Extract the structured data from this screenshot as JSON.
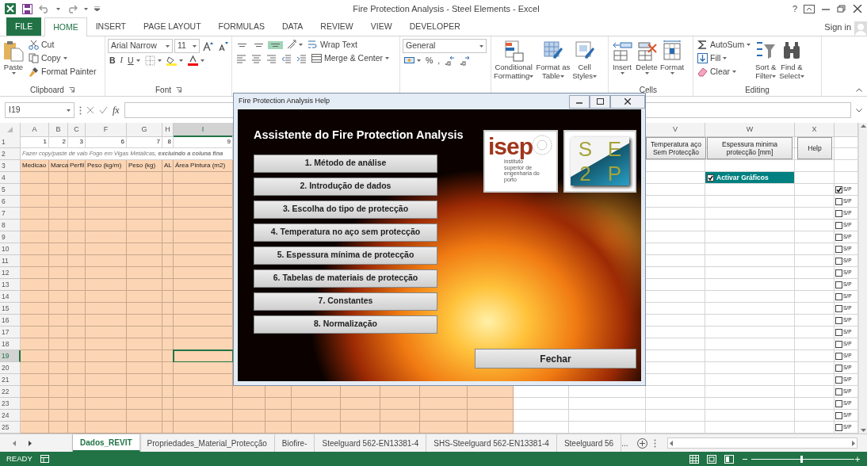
{
  "title_bar": {
    "title": "Fire Protection Analysis - Steel Elements - Excel",
    "help": "?"
  },
  "ribbon_tabs": [
    {
      "label": "FILE",
      "kind": "file",
      "selected": false
    },
    {
      "label": "HOME",
      "kind": "tab",
      "selected": true
    },
    {
      "label": "INSERT",
      "kind": "tab",
      "selected": false
    },
    {
      "label": "PAGE LAYOUT",
      "kind": "tab",
      "selected": false
    },
    {
      "label": "FORMULAS",
      "kind": "tab",
      "selected": false
    },
    {
      "label": "DATA",
      "kind": "tab",
      "selected": false
    },
    {
      "label": "REVIEW",
      "kind": "tab",
      "selected": false
    },
    {
      "label": "VIEW",
      "kind": "tab",
      "selected": false
    },
    {
      "label": "DEVELOPER",
      "kind": "tab",
      "selected": false
    }
  ],
  "sign_in": "Sign in",
  "ribbon": {
    "clipboard": {
      "label": "Clipboard",
      "paste": "Paste",
      "cut": "Cut",
      "copy": "Copy",
      "format_painter": "Format Painter"
    },
    "font": {
      "label": "Font",
      "name": "Arial Narrow",
      "size": "11",
      "bold": "B",
      "italic": "I",
      "underline": "U"
    },
    "alignment": {
      "vertical": [
        {
          "selected": false
        },
        {
          "selected": false
        },
        {
          "selected": true
        }
      ],
      "wrap_text": "Wrap Text",
      "merge_center": "Merge & Center"
    },
    "number": {
      "format": "General",
      "percent": "%",
      "comma": ","
    },
    "styles": [
      {
        "lines": [
          "Conditional",
          "Formatting"
        ]
      },
      {
        "lines": [
          "Format as",
          "Table"
        ]
      },
      {
        "lines": [
          "Cell",
          "Styles"
        ]
      }
    ],
    "cells": {
      "label": "Cells",
      "items": [
        "Insert",
        "Delete",
        "Format"
      ]
    },
    "editing": {
      "label": "Editing",
      "autosum": "AutoSum",
      "fill": "Fill",
      "clear": "Clear",
      "sort": [
        "Sort &",
        "Filter"
      ],
      "find": [
        "Find &",
        "Select"
      ]
    }
  },
  "formula_bar": {
    "name_box": "I19",
    "function_label": "fx"
  },
  "sheet": {
    "columns_left": [
      {
        "label": "A",
        "selected": false
      },
      {
        "label": "B",
        "selected": false
      },
      {
        "label": "C",
        "selected": false
      },
      {
        "label": "F",
        "selected": false
      },
      {
        "label": "G",
        "selected": false
      },
      {
        "label": "H",
        "selected": false
      },
      {
        "label": "I",
        "selected": true
      }
    ],
    "columns_right": [
      {
        "label": "V"
      },
      {
        "label": "W"
      },
      {
        "label": "X"
      }
    ],
    "rows": [
      {
        "number": "1",
        "selected": false,
        "cells": [
          "1",
          "2",
          "3",
          "6",
          "7",
          "8",
          "9"
        ]
      },
      {
        "number": "2",
        "selected": false,
        "note": "Fazer copy/paste de valo Fogo em Vigas Metálicas,  **excluindo a coluna fina**"
      },
      {
        "number": "3",
        "selected": false,
        "headers": [
          "Medicao",
          "Marca",
          "Perfil",
          "Peso (kg/m)",
          "Peso (kg)",
          "AL",
          "Área Pintura (m2)"
        ]
      },
      {
        "number": "4",
        "selected": false
      },
      {
        "number": "5",
        "selected": false,
        "option": {
          "label": "S/P",
          "checked": true
        }
      },
      {
        "number": "6",
        "selected": false,
        "option": {
          "label": "S/P",
          "checked": false
        }
      },
      {
        "number": "7",
        "selected": false,
        "option": {
          "label": "S/P",
          "checked": false
        }
      },
      {
        "number": "8",
        "selected": false,
        "option": {
          "label": "S/P",
          "checked": false
        }
      },
      {
        "number": "9",
        "selected": false,
        "option": {
          "label": "S/P",
          "checked": false
        }
      },
      {
        "number": "10",
        "selected": false,
        "option": {
          "label": "S/P",
          "checked": false
        }
      },
      {
        "number": "11",
        "selected": false,
        "option": {
          "label": "S/P",
          "checked": false
        }
      },
      {
        "number": "12",
        "selected": false,
        "option": {
          "label": "S/P",
          "checked": false
        }
      },
      {
        "number": "13",
        "selected": false,
        "option": {
          "label": "S/P",
          "checked": false
        }
      },
      {
        "number": "14",
        "selected": false,
        "option": {
          "label": "S/P",
          "checked": false
        }
      },
      {
        "number": "15",
        "selected": false,
        "option": {
          "label": "S/P",
          "checked": false
        }
      },
      {
        "number": "16",
        "selected": false,
        "option": {
          "label": "S/P",
          "checked": false
        }
      },
      {
        "number": "17",
        "selected": false,
        "option": {
          "label": "S/P",
          "checked": false
        }
      },
      {
        "number": "18",
        "selected": false,
        "option": {
          "label": "S/P",
          "checked": false
        }
      },
      {
        "number": "19",
        "selected": true,
        "option": {
          "label": "S/P",
          "checked": false
        }
      },
      {
        "number": "20",
        "selected": false,
        "option": {
          "label": "S/P",
          "checked": false
        }
      },
      {
        "number": "21",
        "selected": false,
        "option": {
          "label": "S/P",
          "checked": false
        }
      },
      {
        "number": "22",
        "selected": false,
        "option": {
          "label": "S/P",
          "checked": false
        }
      },
      {
        "number": "23",
        "selected": false,
        "option": {
          "label": "S/P",
          "checked": false
        }
      },
      {
        "number": "24",
        "selected": false,
        "option": {
          "label": "S/P",
          "checked": false
        }
      },
      {
        "number": "25",
        "selected": false,
        "option": {
          "label": "S/P",
          "checked": false
        }
      }
    ]
  },
  "sheet_buttons": [
    {
      "lines": [
        "Temperatura aço",
        "Sem Protecção"
      ]
    },
    {
      "lines": [
        "Espessura minima",
        "protecção [mm]"
      ]
    },
    {
      "lines": [
        "Help"
      ]
    }
  ],
  "graphs_toggle": {
    "label": "Activar Gráficos",
    "checked": true
  },
  "dialog": {
    "title": "Fire Protection Analysis Help",
    "heading": "Assistente do Fire Protection Analysis",
    "buttons": [
      "1. Método de análise",
      "2. Introdução de dados",
      "3. Escolha do tipo de protecção",
      "4. Temperatura no aço sem protecção",
      "5. Espessura mínima de protecção",
      "6. Tabelas de materiais de protecção",
      "7. Constantes",
      "8. Normalização"
    ],
    "isep_logo": {
      "wordmark": "isep",
      "subtitle": [
        "instituto",
        "superior de",
        "engenharia do",
        "porto"
      ]
    },
    "se2p_logo": [
      "S",
      "E",
      "2",
      "P"
    ],
    "close_button": "Fechar"
  },
  "sheet_tabs": [
    {
      "label": "Dados_REVIT",
      "selected": true
    },
    {
      "label": "Propriedades_Material_Protecção",
      "selected": false
    },
    {
      "label": "Biofire-",
      "selected": false
    },
    {
      "label": "Steelguard 562-EN13381-4",
      "selected": false
    },
    {
      "label": "SHS-Steelguard 562-EN13381-4",
      "selected": false
    },
    {
      "label": "Steelguard 56",
      "selected": false
    }
  ],
  "more_tabs": "...",
  "status": "READY"
}
